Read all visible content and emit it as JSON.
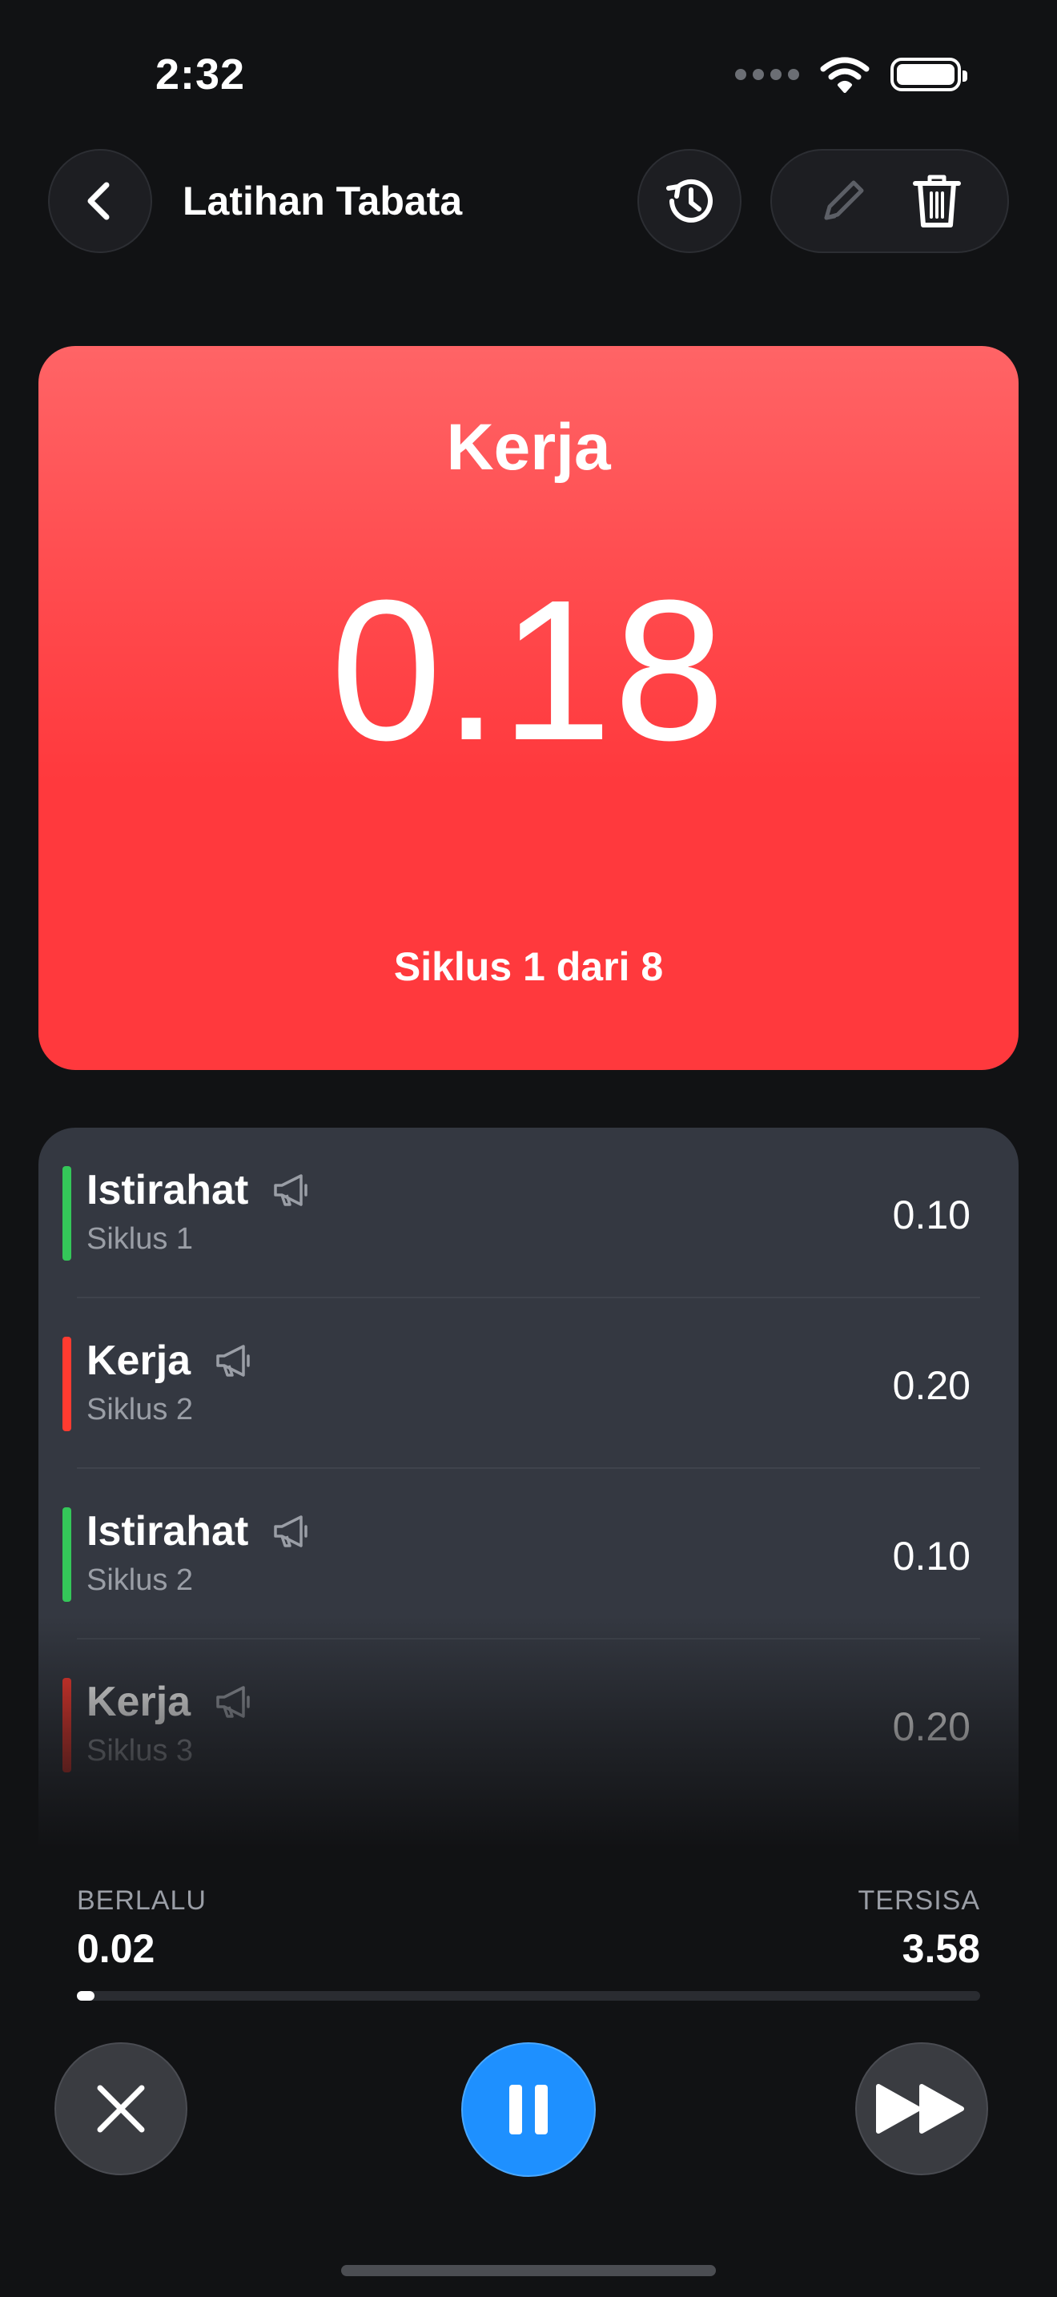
{
  "status_bar": {
    "time": "2:32"
  },
  "header": {
    "title": "Latihan Tabata"
  },
  "current": {
    "phase": "Kerja",
    "timer": "0.18",
    "cycle_text": "Siklus 1 dari 8",
    "color": "#ff393d"
  },
  "intervals": [
    {
      "name": "Istirahat",
      "cycle": "Siklus 1",
      "duration": "0.10",
      "type": "rest"
    },
    {
      "name": "Kerja",
      "cycle": "Siklus 2",
      "duration": "0.20",
      "type": "work"
    },
    {
      "name": "Istirahat",
      "cycle": "Siklus 2",
      "duration": "0.10",
      "type": "rest"
    },
    {
      "name": "Kerja",
      "cycle": "Siklus 3",
      "duration": "0.20",
      "type": "work"
    }
  ],
  "progress": {
    "elapsed_label": "BERLALU",
    "elapsed": "0.02",
    "remaining_label": "TERSISA",
    "remaining": "3.58",
    "fraction": 0.01
  },
  "colors": {
    "rest": "#34c759",
    "work": "#ff3b30",
    "accent": "#1e90ff"
  },
  "icons": [
    "back-chevron-icon",
    "history-icon",
    "pencil-icon",
    "trash-icon",
    "megaphone-icon",
    "close-icon",
    "pause-icon",
    "fast-forward-icon"
  ]
}
